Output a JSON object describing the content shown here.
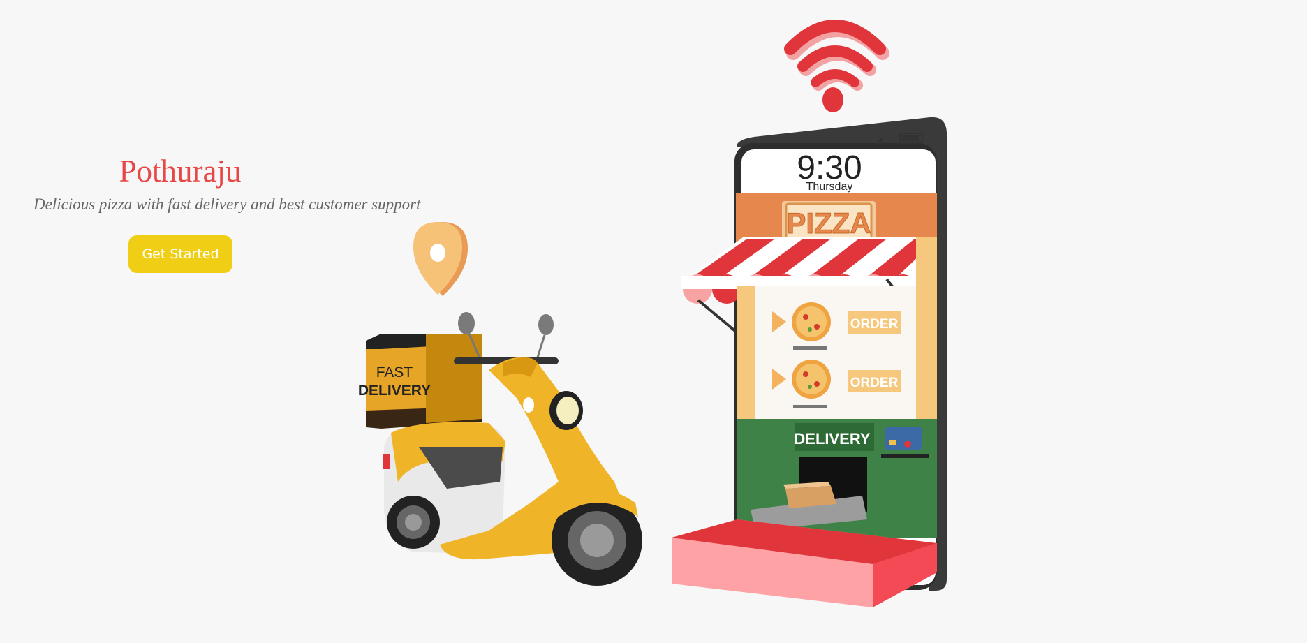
{
  "hero": {
    "title": "Pothuraju",
    "subtitle": "Delicious pizza with fast delivery and best customer support",
    "cta_label": "Get Started"
  },
  "illustration": {
    "phone_time": "9:30",
    "phone_day": "Thursday",
    "shop_sign": "PIZZA",
    "order_label_1": "ORDER",
    "order_label_2": "ORDER",
    "delivery_sign": "DELIVERY",
    "box_line_1": "FAST",
    "box_line_2": "DELIVERY"
  },
  "colors": {
    "title": "#e84747",
    "button": "#f0ce16",
    "background": "#f7f7f7"
  }
}
